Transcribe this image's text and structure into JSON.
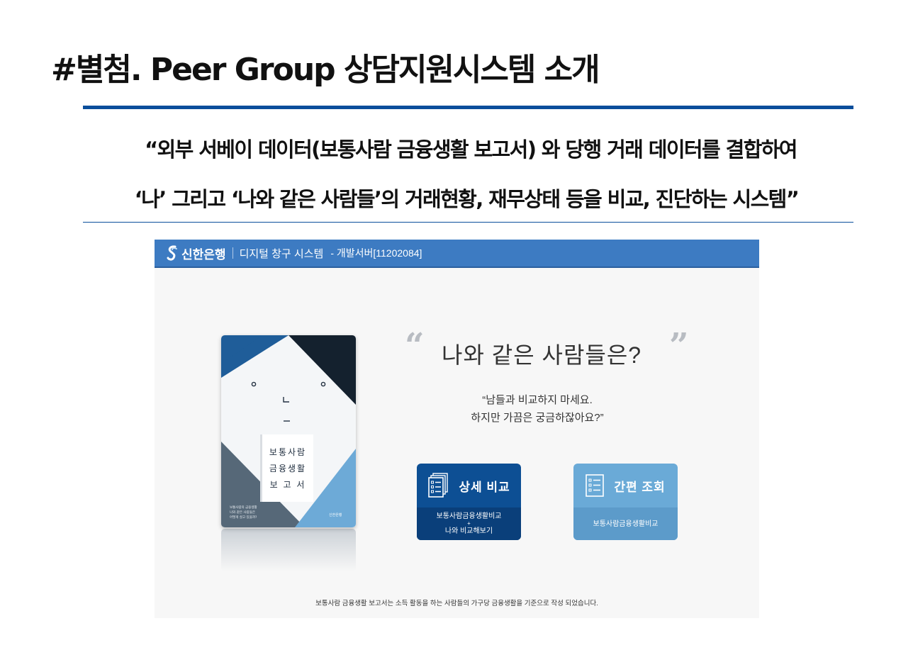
{
  "slide": {
    "title": "#별첨. Peer Group 상담지원시스템 소개",
    "quote_line1": "“외부 서베이 데이터(보통사람 금융생활 보고서) 와 당행 거래 데이터를 결합하여",
    "quote_line2": "‘나’ 그리고 ‘나와 같은 사람들’의 거래현황, 재무상태 등을 비교, 진단하는 시스템”"
  },
  "app": {
    "header": {
      "bank_name": "신한은행",
      "system_name": "디지털 창구 시스템",
      "server_name": "- 개발서버[11202084]"
    },
    "book": {
      "title_lines": [
        "보통사람",
        "금융생활",
        "보 고 서"
      ],
      "small_text": [
        "보통사람의 금융생활",
        "나와 같은 사람들은",
        "어떻게 살고 있을까?"
      ],
      "publisher": "신한은행"
    },
    "question": "나와 같은 사람들은?",
    "subtext_line1": "“남들과 비교하지 마세요.",
    "subtext_line2": "하지만 가끔은 궁금하잖아요?”",
    "buttons": {
      "detail": {
        "label": "상세 비교",
        "sub_line1": "보통사람금융생활비교",
        "sub_plus": "+",
        "sub_line2": "나와 비교해보기"
      },
      "simple": {
        "label": "간편 조회",
        "sub_line1": "보통사람금융생활비교"
      }
    },
    "footnote": "보통사람 금융생활 보고서는 소득 활동을 하는 사람들의 가구당 금융생활을 기준으로 작성 되었습니다."
  },
  "colors": {
    "header_blue": "#3d7bc2",
    "rule_blue": "#0a4e9b",
    "detail_button": "#0d4f94",
    "simple_button": "#6aaad7"
  },
  "icons": {
    "bank_logo": "shinhan-logo",
    "detail_button_icon": "stacked-documents-list-icon",
    "simple_button_icon": "document-list-icon"
  }
}
